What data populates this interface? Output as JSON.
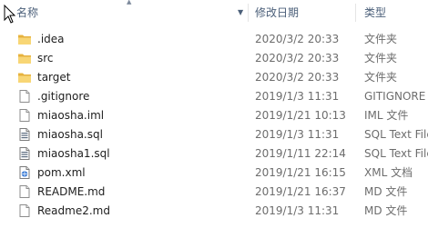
{
  "columns": {
    "name": "名称",
    "date": "修改日期",
    "type": "类型"
  },
  "files": [
    {
      "name": ".idea",
      "date": "2020/3/2 20:33",
      "type": "文件夹",
      "icon": "folder-icon"
    },
    {
      "name": "src",
      "date": "2020/3/2 20:33",
      "type": "文件夹",
      "icon": "folder-icon"
    },
    {
      "name": "target",
      "date": "2020/3/2 20:33",
      "type": "文件夹",
      "icon": "folder-icon"
    },
    {
      "name": ".gitignore",
      "date": "2019/1/3 11:31",
      "type": "GITIGNORE",
      "icon": "file-icon"
    },
    {
      "name": "miaosha.iml",
      "date": "2019/1/21 10:13",
      "type": "IML 文件",
      "icon": "file-icon"
    },
    {
      "name": "miaosha.sql",
      "date": "2019/1/3 11:31",
      "type": "SQL Text File",
      "icon": "sql-file-icon"
    },
    {
      "name": "miaosha1.sql",
      "date": "2019/1/11 22:14",
      "type": "SQL Text File",
      "icon": "sql-file-icon"
    },
    {
      "name": "pom.xml",
      "date": "2019/1/21 16:15",
      "type": "XML 文档",
      "icon": "xml-file-icon"
    },
    {
      "name": "README.md",
      "date": "2019/1/21 16:37",
      "type": "MD 文件",
      "icon": "file-icon"
    },
    {
      "name": "Readme2.md",
      "date": "2019/1/3 11:31",
      "type": "MD 文件",
      "icon": "file-icon"
    }
  ],
  "colors": {
    "header_text": "#4c607a",
    "name_text": "#1e1e1e",
    "detail_text": "#6d6d6d",
    "folder": "#f4c85e"
  }
}
